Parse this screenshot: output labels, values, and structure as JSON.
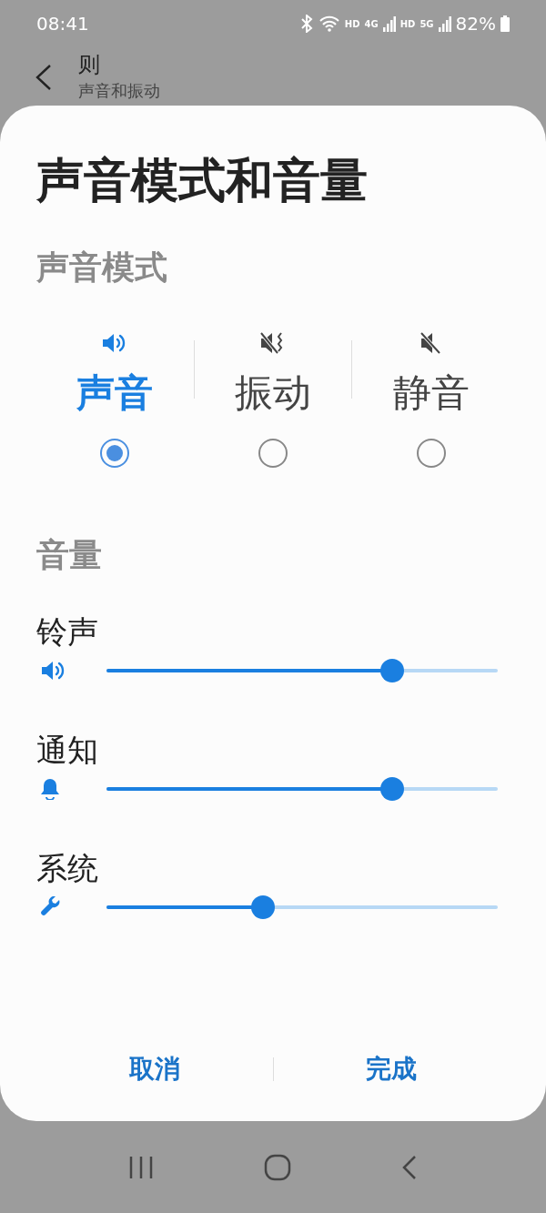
{
  "status_bar": {
    "time": "08:41",
    "network_labels": [
      "HD",
      "4G",
      "HD",
      "5G"
    ],
    "battery": "82%"
  },
  "header": {
    "title": "则",
    "subtitle": "声音和振动"
  },
  "dialog": {
    "title": "声音模式和音量",
    "mode_section": "声音模式",
    "modes": [
      {
        "kind": "sound",
        "label": "声音",
        "selected": true
      },
      {
        "kind": "vibrate",
        "label": "振动",
        "selected": false
      },
      {
        "kind": "mute",
        "label": "静音",
        "selected": false
      }
    ],
    "volume_section": "音量",
    "volumes": [
      {
        "kind": "ringtone",
        "label": "铃声",
        "level": 0.73
      },
      {
        "kind": "notification",
        "label": "通知",
        "level": 0.73
      },
      {
        "kind": "system",
        "label": "系统",
        "level": 0.4
      }
    ],
    "buttons": [
      "取消",
      "完成"
    ]
  }
}
